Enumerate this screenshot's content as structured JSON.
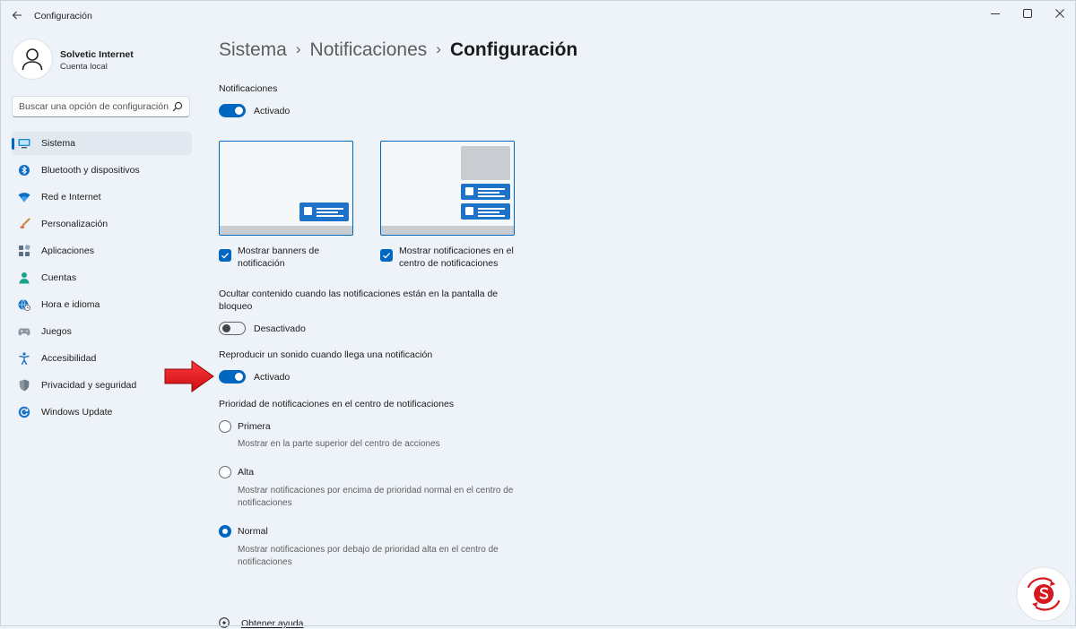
{
  "window": {
    "title": "Configuración",
    "back_icon": "arrow-left-icon",
    "controls": [
      "minimize",
      "maximize",
      "close"
    ]
  },
  "user": {
    "name": "Solvetic Internet",
    "account_type": "Cuenta local"
  },
  "search": {
    "placeholder": "Buscar una opción de configuración"
  },
  "sidebar": {
    "items": [
      {
        "label": "Sistema",
        "icon": "monitor-icon",
        "selected": true
      },
      {
        "label": "Bluetooth y dispositivos",
        "icon": "bluetooth-icon"
      },
      {
        "label": "Red e Internet",
        "icon": "wifi-icon"
      },
      {
        "label": "Personalización",
        "icon": "brush-icon"
      },
      {
        "label": "Aplicaciones",
        "icon": "apps-icon"
      },
      {
        "label": "Cuentas",
        "icon": "person-icon"
      },
      {
        "label": "Hora e idioma",
        "icon": "globe-clock-icon"
      },
      {
        "label": "Juegos",
        "icon": "gamepad-icon"
      },
      {
        "label": "Accesibilidad",
        "icon": "accessibility-icon"
      },
      {
        "label": "Privacidad y seguridad",
        "icon": "shield-icon"
      },
      {
        "label": "Windows Update",
        "icon": "update-icon"
      }
    ]
  },
  "breadcrumb": {
    "items": [
      "Sistema",
      "Notificaciones"
    ],
    "current": "Configuración",
    "separator": "›"
  },
  "notifications": {
    "label": "Notificaciones",
    "toggle_label": "Activado",
    "on": true
  },
  "previews": [
    {
      "label": "Mostrar banners de notificación",
      "checked": true
    },
    {
      "label": "Mostrar notificaciones en el centro de notificaciones",
      "checked": true
    }
  ],
  "hide_content": {
    "label": "Ocultar contenido cuando las notificaciones están en la pantalla de bloqueo",
    "toggle_label": "Desactivado",
    "on": false
  },
  "sound": {
    "label": "Reproducir un sonido cuando llega una notificación",
    "toggle_label": "Activado",
    "on": true
  },
  "priority": {
    "label": "Prioridad de notificaciones en el centro de notificaciones",
    "options": [
      {
        "label": "Primera",
        "description": "Mostrar en la parte superior del centro de acciones",
        "selected": false
      },
      {
        "label": "Alta",
        "description": "Mostrar notificaciones por encima de prioridad normal en el centro de notificaciones",
        "selected": false
      },
      {
        "label": "Normal",
        "description": "Mostrar notificaciones por debajo de prioridad alta en el centro de notificaciones",
        "selected": true
      }
    ]
  },
  "help": {
    "label": "Obtener ayuda",
    "icon": "help-icon"
  },
  "annotation": {
    "icon": "red-arrow-icon",
    "color": "#e8141c"
  },
  "colors": {
    "accent": "#0067c0",
    "background": "#eef3f9"
  }
}
